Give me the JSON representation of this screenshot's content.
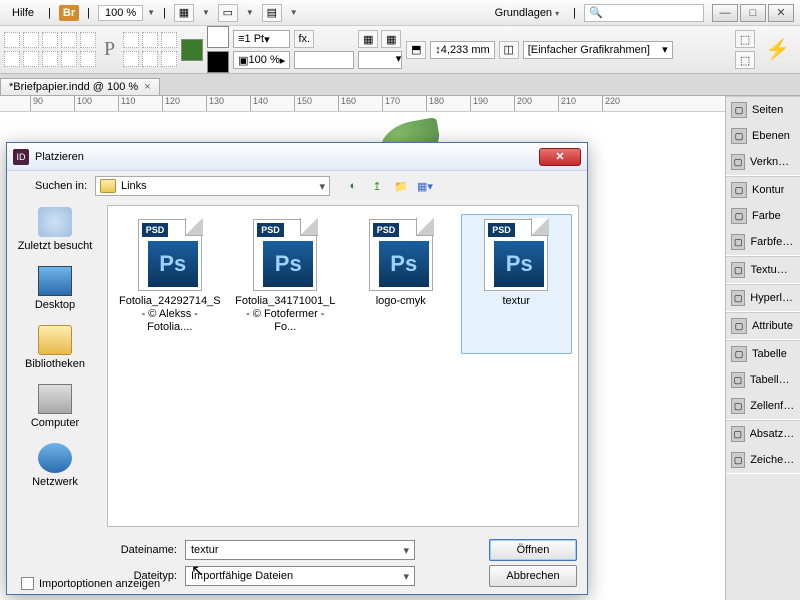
{
  "menubar": {
    "help": "Hilfe",
    "br": "Br",
    "zoom": "100 %",
    "workspace": "Grundlagen"
  },
  "ctrlbar": {
    "pt": "1 Pt",
    "hundred": "100 %",
    "mm": "4,233 mm",
    "frame": "[Einfacher Grafikrahmen]"
  },
  "doctab": {
    "label": "*Briefpapier.indd @ 100 %"
  },
  "ruler": {
    "ticks": [
      90,
      100,
      110,
      120,
      130,
      140,
      150,
      160,
      170,
      180,
      190,
      200,
      210,
      220
    ]
  },
  "panels": [
    [
      "Seiten",
      "Ebenen",
      "Verknüpf..."
    ],
    [
      "Kontur",
      "Farbe",
      "Farbfelder"
    ],
    [
      "Textumfl..."
    ],
    [
      "Hyperlinks"
    ],
    [
      "Attribute"
    ],
    [
      "Tabelle",
      "Tabellenf...",
      "Zellenfor..."
    ],
    [
      "Absatzfor...",
      "Zeichenf..."
    ]
  ],
  "dialog": {
    "title": "Platzieren",
    "searchin_label": "Suchen in:",
    "folder": "Links",
    "places": {
      "recent": "Zuletzt besucht",
      "desktop": "Desktop",
      "libs": "Bibliotheken",
      "computer": "Computer",
      "network": "Netzwerk"
    },
    "files": [
      {
        "name": "Fotolia_24292714_S - © Alekss - Fotolia...."
      },
      {
        "name": "Fotolia_34171001_L - © Fotofermer - Fo..."
      },
      {
        "name": "logo-cmyk"
      },
      {
        "name": "textur",
        "selected": true
      }
    ],
    "filename_label": "Dateiname:",
    "filename_value": "textur",
    "filetype_label": "Dateityp:",
    "filetype_value": "Importfähige Dateien",
    "open": "Öffnen",
    "cancel": "Abbrechen",
    "import_options": "Importoptionen anzeigen"
  }
}
